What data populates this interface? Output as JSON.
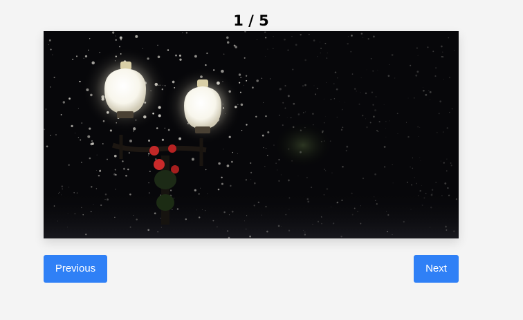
{
  "slideshow": {
    "current": 1,
    "total": 5,
    "counter_text": "1 / 5",
    "image_subject": "street-lamp-in-snowfall-at-night"
  },
  "controls": {
    "previous_label": "Previous",
    "next_label": "Next"
  },
  "colors": {
    "page_background": "#f4f4f4",
    "button_background": "#2f80f6",
    "button_text": "#ffffff"
  }
}
